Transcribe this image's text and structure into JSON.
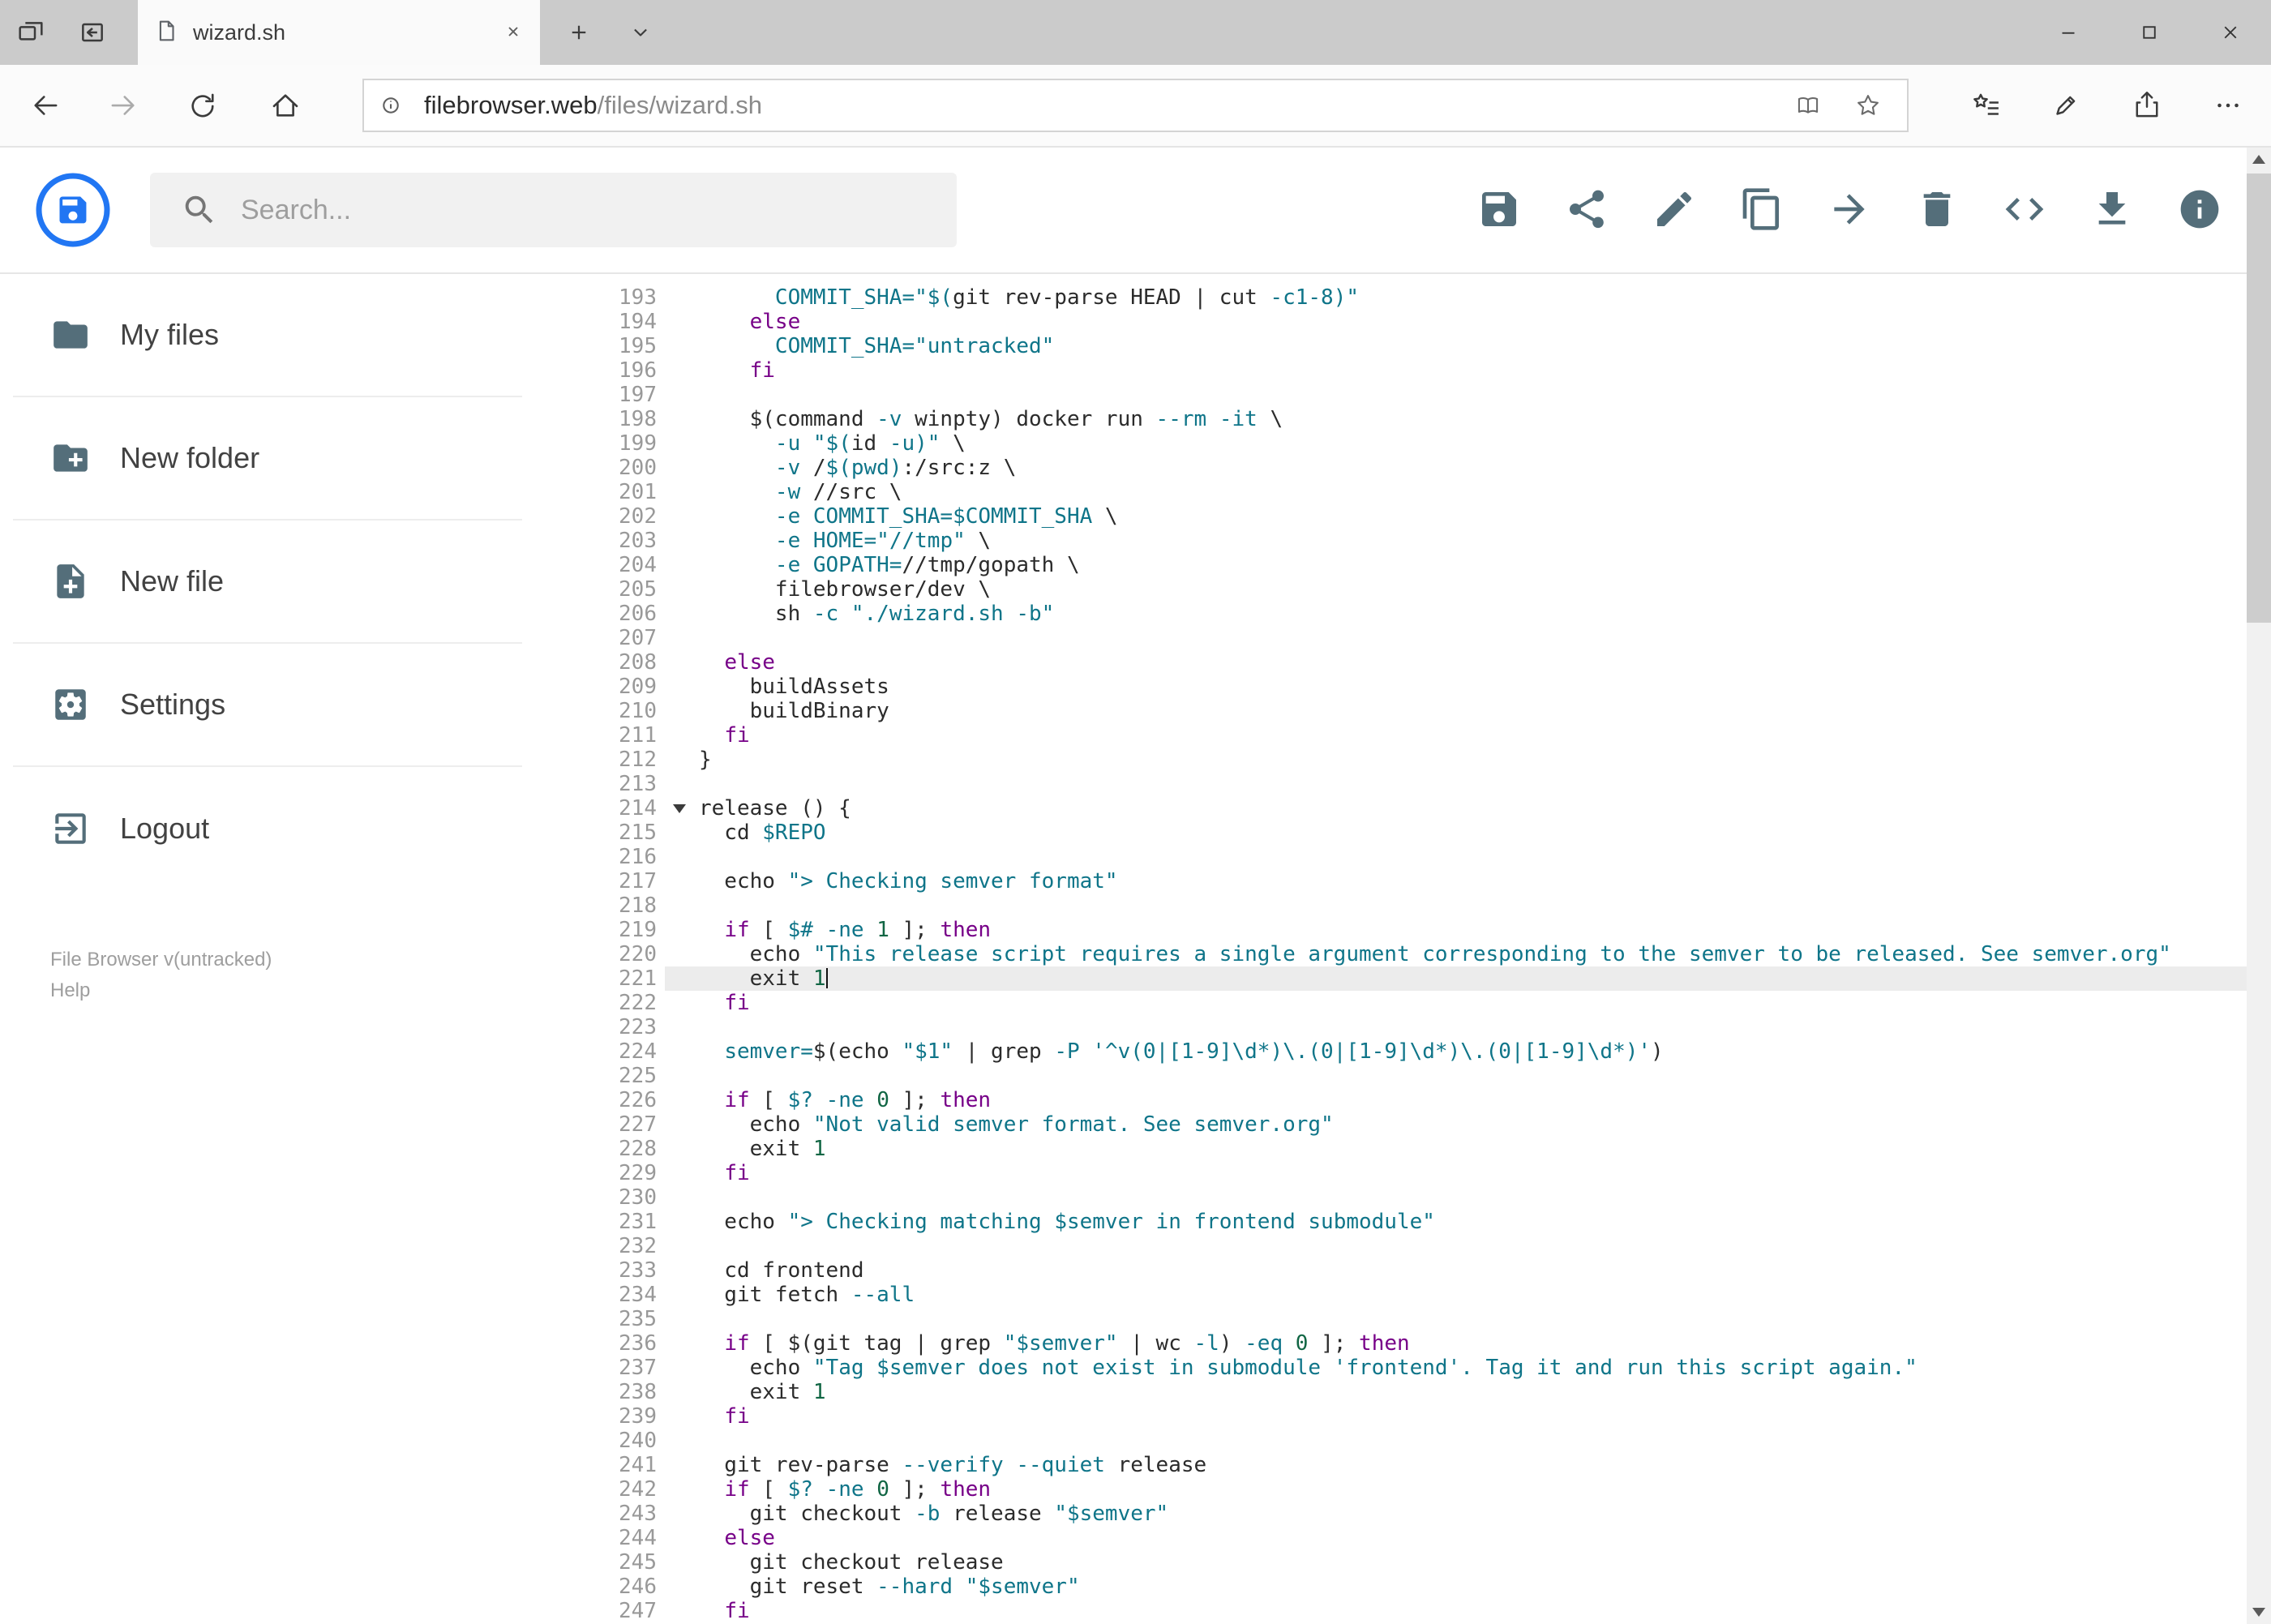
{
  "browser": {
    "tab_title": "wizard.sh",
    "url": {
      "host": "filebrowser.web",
      "path": "/files/wizard.sh"
    },
    "tab_icons": [
      "tab-preview",
      "set-tabs-aside",
      "page",
      "tab-close",
      "new-tab",
      "tab-list-chevron"
    ],
    "toolbar_icons": [
      "back",
      "forward",
      "refresh",
      "home",
      "info",
      "reading-view",
      "favorite-star",
      "hub",
      "web-note",
      "share",
      "more"
    ],
    "window_icons": [
      "minimize",
      "maximize",
      "close"
    ]
  },
  "header": {
    "search_placeholder": "Search...",
    "actions": [
      {
        "id": "save",
        "icon": "save"
      },
      {
        "id": "share",
        "icon": "share"
      },
      {
        "id": "rename",
        "icon": "edit"
      },
      {
        "id": "copy",
        "icon": "copy"
      },
      {
        "id": "move",
        "icon": "move"
      },
      {
        "id": "delete",
        "icon": "delete"
      },
      {
        "id": "raw-code",
        "icon": "code"
      },
      {
        "id": "download",
        "icon": "download"
      },
      {
        "id": "info",
        "icon": "info"
      }
    ]
  },
  "sidebar": {
    "items": [
      {
        "id": "my-files",
        "icon": "folder",
        "label": "My files"
      },
      {
        "id": "new-folder",
        "icon": "create-new-folder",
        "label": "New folder"
      },
      {
        "id": "new-file",
        "icon": "note-add",
        "label": "New file"
      },
      {
        "id": "settings",
        "icon": "settings",
        "label": "Settings"
      },
      {
        "id": "logout",
        "icon": "logout",
        "label": "Logout"
      }
    ],
    "footer_version": "File Browser v(untracked)",
    "footer_help": "Help"
  },
  "colors": {
    "accent_blue": "#2176f3",
    "icon_gray": "#546e7a",
    "keyword_purple": "#770088",
    "string_teal": "#0f7589",
    "number_green": "#116644",
    "active_line_bg": "#ececec"
  },
  "editor": {
    "first_visible_line": 193,
    "last_visible_line": 247,
    "active_line": 221,
    "cursor_line": 221,
    "fold_marker_line": 214,
    "lines": [
      {
        "n": 193,
        "t": [
          [
            "p",
            "      "
          ],
          [
            "v",
            "COMMIT_SHA="
          ],
          [
            "s",
            "\"$("
          ],
          [
            "p",
            "git rev-parse HEAD | cut "
          ],
          [
            "a",
            "-c1-8"
          ],
          [
            "s",
            ")\""
          ]
        ]
      },
      {
        "n": 194,
        "t": [
          [
            "p",
            "    "
          ],
          [
            "k",
            "else"
          ]
        ]
      },
      {
        "n": 195,
        "t": [
          [
            "p",
            "      "
          ],
          [
            "v",
            "COMMIT_SHA="
          ],
          [
            "s",
            "\"untracked\""
          ]
        ]
      },
      {
        "n": 196,
        "t": [
          [
            "p",
            "    "
          ],
          [
            "k",
            "fi"
          ]
        ]
      },
      {
        "n": 197,
        "t": []
      },
      {
        "n": 198,
        "t": [
          [
            "p",
            "    $(command "
          ],
          [
            "a",
            "-v"
          ],
          [
            "p",
            " winpty) docker run "
          ],
          [
            "a",
            "--rm"
          ],
          [
            "p",
            " "
          ],
          [
            "a",
            "-it"
          ],
          [
            "p",
            " \\"
          ]
        ]
      },
      {
        "n": 199,
        "t": [
          [
            "p",
            "      "
          ],
          [
            "a",
            "-u"
          ],
          [
            "p",
            " "
          ],
          [
            "s",
            "\"$("
          ],
          [
            "p",
            "id "
          ],
          [
            "a",
            "-u"
          ],
          [
            "s",
            ")\""
          ],
          [
            "p",
            " \\"
          ]
        ]
      },
      {
        "n": 200,
        "t": [
          [
            "p",
            "      "
          ],
          [
            "a",
            "-v"
          ],
          [
            "p",
            " /"
          ],
          [
            "v",
            "$(pwd)"
          ],
          [
            "p",
            ":/src:z \\"
          ]
        ]
      },
      {
        "n": 201,
        "t": [
          [
            "p",
            "      "
          ],
          [
            "a",
            "-w"
          ],
          [
            "p",
            " //src \\"
          ]
        ]
      },
      {
        "n": 202,
        "t": [
          [
            "p",
            "      "
          ],
          [
            "a",
            "-e"
          ],
          [
            "p",
            " "
          ],
          [
            "v",
            "COMMIT_SHA=$COMMIT_SHA"
          ],
          [
            "p",
            " \\"
          ]
        ]
      },
      {
        "n": 203,
        "t": [
          [
            "p",
            "      "
          ],
          [
            "a",
            "-e"
          ],
          [
            "p",
            " "
          ],
          [
            "v",
            "HOME="
          ],
          [
            "s",
            "\"//tmp\""
          ],
          [
            "p",
            " \\"
          ]
        ]
      },
      {
        "n": 204,
        "t": [
          [
            "p",
            "      "
          ],
          [
            "a",
            "-e"
          ],
          [
            "p",
            " "
          ],
          [
            "v",
            "GOPATH="
          ],
          [
            "p",
            "//tmp/gopath \\"
          ]
        ]
      },
      {
        "n": 205,
        "t": [
          [
            "p",
            "      filebrowser/dev \\"
          ]
        ]
      },
      {
        "n": 206,
        "t": [
          [
            "p",
            "      sh "
          ],
          [
            "a",
            "-c"
          ],
          [
            "p",
            " "
          ],
          [
            "s",
            "\"./wizard.sh -b\""
          ]
        ]
      },
      {
        "n": 207,
        "t": []
      },
      {
        "n": 208,
        "t": [
          [
            "p",
            "  "
          ],
          [
            "k",
            "else"
          ]
        ]
      },
      {
        "n": 209,
        "t": [
          [
            "p",
            "    buildAssets"
          ]
        ]
      },
      {
        "n": 210,
        "t": [
          [
            "p",
            "    buildBinary"
          ]
        ]
      },
      {
        "n": 211,
        "t": [
          [
            "p",
            "  "
          ],
          [
            "k",
            "fi"
          ]
        ]
      },
      {
        "n": 212,
        "t": [
          [
            "p",
            "}"
          ]
        ]
      },
      {
        "n": 213,
        "t": []
      },
      {
        "n": 214,
        "t": [
          [
            "p",
            "release () {"
          ]
        ]
      },
      {
        "n": 215,
        "t": [
          [
            "p",
            "  cd "
          ],
          [
            "v",
            "$REPO"
          ]
        ]
      },
      {
        "n": 216,
        "t": []
      },
      {
        "n": 217,
        "t": [
          [
            "p",
            "  echo "
          ],
          [
            "s",
            "\"> Checking semver format\""
          ]
        ]
      },
      {
        "n": 218,
        "t": []
      },
      {
        "n": 219,
        "t": [
          [
            "p",
            "  "
          ],
          [
            "k",
            "if"
          ],
          [
            "p",
            " [ "
          ],
          [
            "v",
            "$#"
          ],
          [
            "p",
            " "
          ],
          [
            "a",
            "-ne"
          ],
          [
            "p",
            " "
          ],
          [
            "n",
            "1"
          ],
          [
            "p",
            " ]; "
          ],
          [
            "k",
            "then"
          ]
        ]
      },
      {
        "n": 220,
        "t": [
          [
            "p",
            "    echo "
          ],
          [
            "s",
            "\"This release script requires a single argument corresponding to the semver to be released. See semver.org\""
          ]
        ]
      },
      {
        "n": 221,
        "t": [
          [
            "p",
            "    exit "
          ],
          [
            "n",
            "1"
          ]
        ]
      },
      {
        "n": 222,
        "t": [
          [
            "p",
            "  "
          ],
          [
            "k",
            "fi"
          ]
        ]
      },
      {
        "n": 223,
        "t": []
      },
      {
        "n": 224,
        "t": [
          [
            "p",
            "  "
          ],
          [
            "v",
            "semver="
          ],
          [
            "p",
            "$(echo "
          ],
          [
            "s",
            "\"$1\""
          ],
          [
            "p",
            " | grep "
          ],
          [
            "a",
            "-P"
          ],
          [
            "p",
            " "
          ],
          [
            "s",
            "'^v(0|[1-9]\\d*)\\.(0|[1-9]\\d*)\\.(0|[1-9]\\d*)'"
          ],
          [
            "p",
            ")"
          ]
        ]
      },
      {
        "n": 225,
        "t": []
      },
      {
        "n": 226,
        "t": [
          [
            "p",
            "  "
          ],
          [
            "k",
            "if"
          ],
          [
            "p",
            " [ "
          ],
          [
            "v",
            "$?"
          ],
          [
            "p",
            " "
          ],
          [
            "a",
            "-ne"
          ],
          [
            "p",
            " "
          ],
          [
            "n",
            "0"
          ],
          [
            "p",
            " ]; "
          ],
          [
            "k",
            "then"
          ]
        ]
      },
      {
        "n": 227,
        "t": [
          [
            "p",
            "    echo "
          ],
          [
            "s",
            "\"Not valid semver format. See semver.org\""
          ]
        ]
      },
      {
        "n": 228,
        "t": [
          [
            "p",
            "    exit "
          ],
          [
            "n",
            "1"
          ]
        ]
      },
      {
        "n": 229,
        "t": [
          [
            "p",
            "  "
          ],
          [
            "k",
            "fi"
          ]
        ]
      },
      {
        "n": 230,
        "t": []
      },
      {
        "n": 231,
        "t": [
          [
            "p",
            "  echo "
          ],
          [
            "s",
            "\"> Checking matching "
          ],
          [
            "v",
            "$semver"
          ],
          [
            "s",
            " in frontend submodule\""
          ]
        ]
      },
      {
        "n": 232,
        "t": []
      },
      {
        "n": 233,
        "t": [
          [
            "p",
            "  cd frontend"
          ]
        ]
      },
      {
        "n": 234,
        "t": [
          [
            "p",
            "  git fetch "
          ],
          [
            "a",
            "--all"
          ]
        ]
      },
      {
        "n": 235,
        "t": []
      },
      {
        "n": 236,
        "t": [
          [
            "p",
            "  "
          ],
          [
            "k",
            "if"
          ],
          [
            "p",
            " [ $(git tag | grep "
          ],
          [
            "s",
            "\"$semver\""
          ],
          [
            "p",
            " | wc "
          ],
          [
            "a",
            "-l"
          ],
          [
            "p",
            ") "
          ],
          [
            "a",
            "-eq"
          ],
          [
            "p",
            " "
          ],
          [
            "n",
            "0"
          ],
          [
            "p",
            " ]; "
          ],
          [
            "k",
            "then"
          ]
        ]
      },
      {
        "n": 237,
        "t": [
          [
            "p",
            "    echo "
          ],
          [
            "s",
            "\"Tag "
          ],
          [
            "v",
            "$semver"
          ],
          [
            "s",
            " does not exist in submodule 'frontend'. Tag it and run this script again.\""
          ]
        ]
      },
      {
        "n": 238,
        "t": [
          [
            "p",
            "    exit "
          ],
          [
            "n",
            "1"
          ]
        ]
      },
      {
        "n": 239,
        "t": [
          [
            "p",
            "  "
          ],
          [
            "k",
            "fi"
          ]
        ]
      },
      {
        "n": 240,
        "t": []
      },
      {
        "n": 241,
        "t": [
          [
            "p",
            "  git rev-parse "
          ],
          [
            "a",
            "--verify"
          ],
          [
            "p",
            " "
          ],
          [
            "a",
            "--quiet"
          ],
          [
            "p",
            " release"
          ]
        ]
      },
      {
        "n": 242,
        "t": [
          [
            "p",
            "  "
          ],
          [
            "k",
            "if"
          ],
          [
            "p",
            " [ "
          ],
          [
            "v",
            "$?"
          ],
          [
            "p",
            " "
          ],
          [
            "a",
            "-ne"
          ],
          [
            "p",
            " "
          ],
          [
            "n",
            "0"
          ],
          [
            "p",
            " ]; "
          ],
          [
            "k",
            "then"
          ]
        ]
      },
      {
        "n": 243,
        "t": [
          [
            "p",
            "    git checkout "
          ],
          [
            "a",
            "-b"
          ],
          [
            "p",
            " release "
          ],
          [
            "s",
            "\"$semver\""
          ]
        ]
      },
      {
        "n": 244,
        "t": [
          [
            "p",
            "  "
          ],
          [
            "k",
            "else"
          ]
        ]
      },
      {
        "n": 245,
        "t": [
          [
            "p",
            "    git checkout release"
          ]
        ]
      },
      {
        "n": 246,
        "t": [
          [
            "p",
            "    git reset "
          ],
          [
            "a",
            "--hard"
          ],
          [
            "p",
            " "
          ],
          [
            "s",
            "\"$semver\""
          ]
        ]
      },
      {
        "n": 247,
        "t": [
          [
            "p",
            "  "
          ],
          [
            "k",
            "fi"
          ]
        ]
      }
    ]
  }
}
